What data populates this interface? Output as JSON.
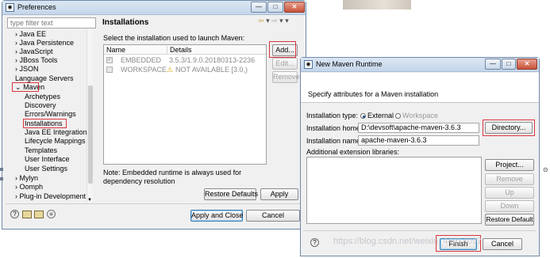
{
  "preferences": {
    "title": "Preferences",
    "filter_placeholder": "type filter text",
    "tree": [
      {
        "label": "Java EE",
        "expander": "›"
      },
      {
        "label": "Java Persistence",
        "expander": "›"
      },
      {
        "label": "JavaScript",
        "expander": "›"
      },
      {
        "label": "JBoss Tools",
        "expander": "›"
      },
      {
        "label": "JSON",
        "expander": "›"
      },
      {
        "label": "Language Servers",
        "expander": ""
      },
      {
        "label": "Maven",
        "expander": "⌄"
      },
      {
        "label": "Archetypes"
      },
      {
        "label": "Discovery"
      },
      {
        "label": "Errors/Warnings"
      },
      {
        "label": "Installations"
      },
      {
        "label": "Java EE Integration"
      },
      {
        "label": "Lifecycle Mappings"
      },
      {
        "label": "Templates"
      },
      {
        "label": "User Interface"
      },
      {
        "label": "User Settings"
      },
      {
        "label": "Mylyn",
        "expander": "›"
      },
      {
        "label": "Oomph",
        "expander": "›"
      },
      {
        "label": "Plug-in Development",
        "expander": "›"
      }
    ],
    "page_title": "Installations",
    "instruction": "Select the installation used to launch Maven:",
    "table": {
      "headers": [
        "Name",
        "Details"
      ],
      "rows": [
        {
          "name": "EMBEDDED",
          "details": "3.5.3/1.9.0.20180313-2236",
          "checked": "✓"
        },
        {
          "name": "WORKSPACE",
          "details": "NOT AVAILABLE [3.0,)",
          "checked": ""
        }
      ]
    },
    "buttons": {
      "add": "Add...",
      "edit": "Edit...",
      "remove": "Remove",
      "restore_defaults": "Restore Defaults",
      "apply": "Apply",
      "apply_close": "Apply and Close",
      "cancel": "Cancel"
    },
    "note": "Note: Embedded runtime is always used for dependency resolution",
    "nav": {
      "back": "⇦",
      "fwd": "⇨",
      "menu": "▾"
    }
  },
  "maven_runtime": {
    "title": "New Maven Runtime",
    "description": "Specify attributes for a Maven installation",
    "installation_type_label": "Installation type:",
    "type_external": "External",
    "type_workspace": "Workspace",
    "installation_home_label": "Installation home:",
    "installation_home_value": "D:\\devsoft\\apache-maven-3.6.3",
    "installation_name_label": "Installation name:",
    "installation_name_value": "apache-maven-3.6.3",
    "directory_button": "Directory...",
    "extension_label": "Additional extension libraries:",
    "buttons": {
      "project": "Project...",
      "remove": "Remove",
      "up": "Up",
      "down": "Down",
      "restore_default": "Restore Default",
      "finish": "Finish",
      "cancel": "Cancel"
    }
  },
  "window_controls": {
    "minimize": "—",
    "maximize": "□",
    "close": "✕"
  },
  "watermark": "https://blog.csdn.net/weixin_44914097",
  "colors": {
    "highlight": "#d9363e",
    "title_bar": "#c5d6ea",
    "accent": "#3c7fb1"
  }
}
